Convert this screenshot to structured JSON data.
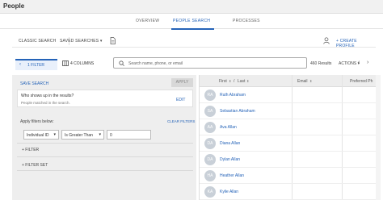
{
  "header": {
    "title": "People"
  },
  "tabs": [
    {
      "label": "OVERVIEW"
    },
    {
      "label": "PEOPLE SEARCH"
    },
    {
      "label": "PROCESSES"
    }
  ],
  "toolbar": {
    "classic_search": "CLASSIC SEARCH",
    "saved_searches": "SAVED SEARCHES",
    "create_profile": "+ CREATE PROFILE"
  },
  "filter_bar": {
    "filter_count": "1 FILTER",
    "columns": "4 COLUMNS",
    "results": "460 Results",
    "actions": "ACTIONS"
  },
  "search": {
    "placeholder": "Search name, phone, or email"
  },
  "left_panel": {
    "save_search": "SAVE SEARCH",
    "apply": "APPLY",
    "question": "Who shows up in the results?",
    "description": "People matched in the search.",
    "edit": "EDIT",
    "apply_below": "Apply filters below:",
    "clear_filters": "CLEAR FILTERS",
    "field": "Individual ID",
    "operator": "Is Greater Than",
    "value": "0",
    "add_filter": "+ FILTER",
    "add_filter_set": "+ FILTER SET"
  },
  "table": {
    "headers": [
      "First",
      "/",
      "Last",
      "Email",
      "Preferred Ph"
    ],
    "rows": [
      {
        "initials": "RA",
        "name": "Ruth Abraham"
      },
      {
        "initials": "SA",
        "name": "Sebastian Abraham"
      },
      {
        "initials": "AA",
        "name": "Ava Allan"
      },
      {
        "initials": "DA",
        "name": "Diana Allan"
      },
      {
        "initials": "DA",
        "name": "Dylan Allan"
      },
      {
        "initials": "HA",
        "name": "Heather Allan"
      },
      {
        "initials": "KA",
        "name": "Kylie Allan"
      }
    ]
  }
}
